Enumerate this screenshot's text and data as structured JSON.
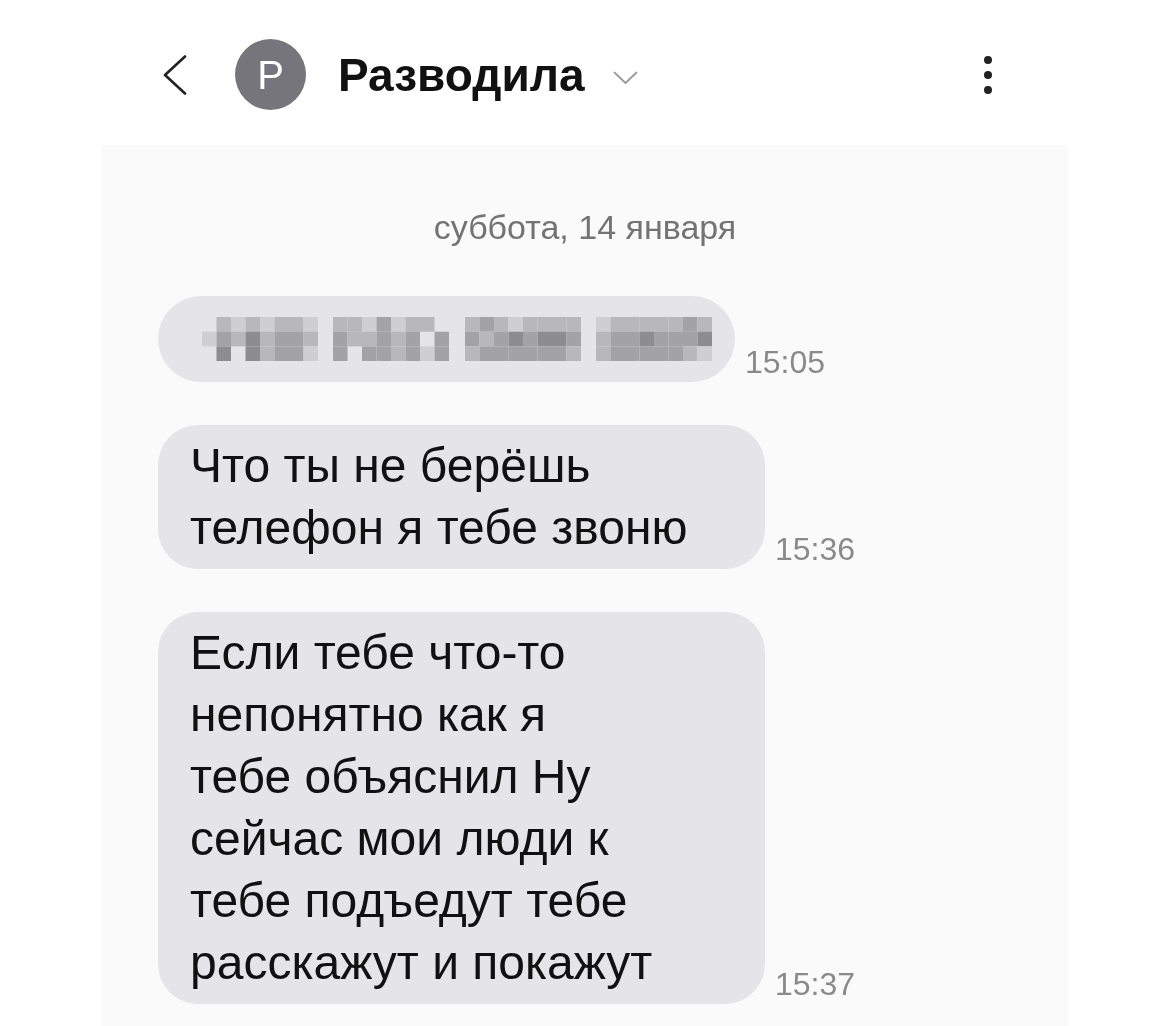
{
  "header": {
    "avatar_letter": "Р",
    "contact_name": "Разводила"
  },
  "conversation": {
    "date": "суббота, 14 января",
    "messages": [
      {
        "kind": "pixelated",
        "time": "15:05"
      },
      {
        "kind": "text",
        "text": "Что ты не берёшь телефон я тебе звоню",
        "time": "15:36"
      },
      {
        "kind": "text",
        "text": "Если тебе что-то непонятно как я тебе объяснил Ну сейчас мои люди к тебе подъедут тебе расскажут и покажут",
        "time": "15:37"
      }
    ]
  }
}
